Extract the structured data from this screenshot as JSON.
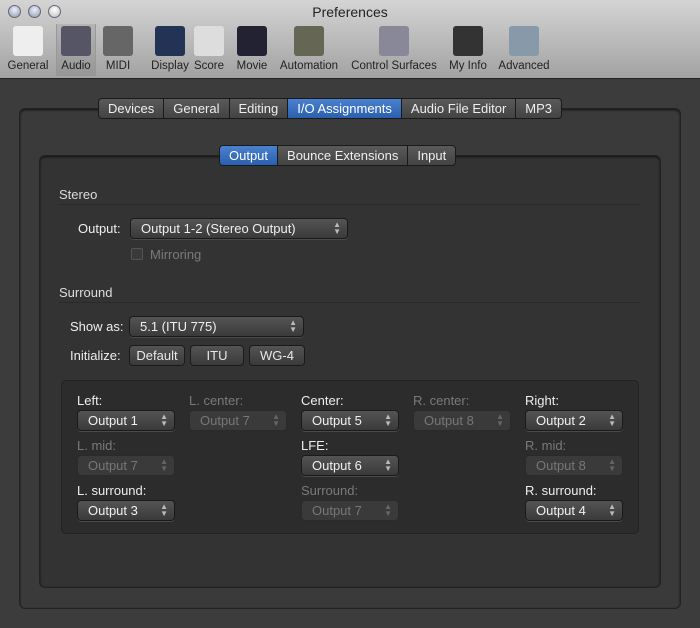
{
  "window": {
    "title": "Preferences"
  },
  "toolbar": [
    {
      "label": "General",
      "icon": "switch-icon",
      "selected": false
    },
    {
      "label": "Audio",
      "icon": "waveform-icon",
      "selected": true
    },
    {
      "label": "MIDI",
      "icon": "midi-connector-icon",
      "selected": false
    },
    {
      "label": "Display",
      "icon": "monitor-icon",
      "selected": false
    },
    {
      "label": "Score",
      "icon": "music-notes-icon",
      "selected": false
    },
    {
      "label": "Movie",
      "icon": "clapperboard-icon",
      "selected": false
    },
    {
      "label": "Automation",
      "icon": "automation-curve-icon",
      "selected": false
    },
    {
      "label": "Control Surfaces",
      "icon": "faders-icon",
      "selected": false
    },
    {
      "label": "My Info",
      "icon": "person-silhouette-icon",
      "selected": false
    },
    {
      "label": "Advanced",
      "icon": "gear-icon",
      "selected": false
    }
  ],
  "tabs": [
    "Devices",
    "General",
    "Editing",
    "I/O Assignments",
    "Audio File Editor",
    "MP3"
  ],
  "active_tab": "I/O Assignments",
  "subtabs": [
    "Output",
    "Bounce Extensions",
    "Input"
  ],
  "active_subtab": "Output",
  "stereo": {
    "heading": "Stereo",
    "output_label": "Output:",
    "output_value": "Output 1-2 (Stereo Output)",
    "mirroring_label": "Mirroring",
    "mirroring_checked": false
  },
  "surround": {
    "heading": "Surround",
    "show_as_label": "Show as:",
    "show_as_value": "5.1 (ITU 775)",
    "initialize_label": "Initialize:",
    "init_buttons": [
      "Default",
      "ITU",
      "WG-4"
    ],
    "channels": [
      {
        "label": "Left:",
        "value": "Output 1",
        "enabled": true
      },
      {
        "label": "L. center:",
        "value": "Output 7",
        "enabled": false
      },
      {
        "label": "Center:",
        "value": "Output 5",
        "enabled": true
      },
      {
        "label": "R. center:",
        "value": "Output 8",
        "enabled": false
      },
      {
        "label": "Right:",
        "value": "Output 2",
        "enabled": true
      },
      {
        "label": "L. mid:",
        "value": "Output 7",
        "enabled": false
      },
      {
        "label": "LFE:",
        "value": "Output 6",
        "enabled": true
      },
      {
        "label": "R. mid:",
        "value": "Output 8",
        "enabled": false
      },
      {
        "label": "L. surround:",
        "value": "Output 3",
        "enabled": true
      },
      {
        "label": "Surround:",
        "value": "Output 7",
        "enabled": false
      },
      {
        "label": "R. surround:",
        "value": "Output 4",
        "enabled": true
      }
    ]
  }
}
